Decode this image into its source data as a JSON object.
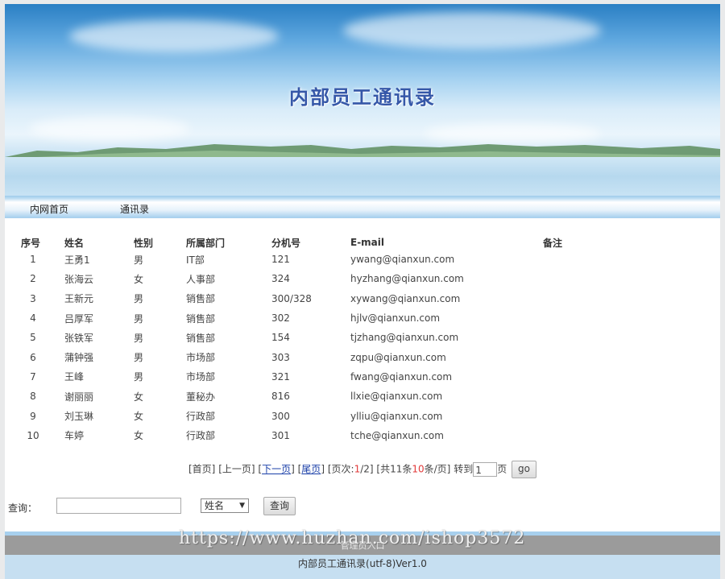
{
  "banner": {
    "title": "内部员工通讯录"
  },
  "nav": {
    "items": [
      "内网首页",
      "通讯录"
    ]
  },
  "table": {
    "headers": [
      "序号",
      "姓名",
      "性别",
      "所属部门",
      "分机号",
      "E-mail",
      "备注"
    ],
    "rows": [
      [
        "1",
        "王勇1",
        "男",
        "IT部",
        "121",
        "ywang@qianxun.com",
        ""
      ],
      [
        "2",
        "张海云",
        "女",
        "人事部",
        "324",
        "hyzhang@qianxun.com",
        ""
      ],
      [
        "3",
        "王新元",
        "男",
        "销售部",
        "300/328",
        "xywang@qianxun.com",
        ""
      ],
      [
        "4",
        "吕厚军",
        "男",
        "销售部",
        "302",
        "hjlv@qianxun.com",
        ""
      ],
      [
        "5",
        "张铁军",
        "男",
        "销售部",
        "154",
        "tjzhang@qianxun.com",
        ""
      ],
      [
        "6",
        "蒲钟强",
        "男",
        "市场部",
        "303",
        "zqpu@qianxun.com",
        ""
      ],
      [
        "7",
        "王峰",
        "男",
        "市场部",
        "321",
        "fwang@qianxun.com",
        ""
      ],
      [
        "8",
        "谢丽丽",
        "女",
        "董秘办",
        "816",
        "llxie@qianxun.com",
        ""
      ],
      [
        "9",
        "刘玉琳",
        "女",
        "行政部",
        "300",
        "ylliu@qianxun.com",
        ""
      ],
      [
        "10",
        "车婷",
        "女",
        "行政部",
        "301",
        "tche@qianxun.com",
        ""
      ]
    ]
  },
  "pager": {
    "first": "[首页]",
    "prev": "[上一页]",
    "next_open": "[",
    "next": "下一页",
    "next_close": "]",
    "last_open": "[",
    "last": "尾页",
    "last_close": "]",
    "pageinfo_prefix": "[页次:",
    "current_page": "1",
    "total_pages": "/2]",
    "total_prefix": "[共11条",
    "per_page": "10",
    "per_page_suffix": "条/页]",
    "goto_label": "转到",
    "goto_value": "1",
    "page_unit": "页",
    "go_label": "go"
  },
  "search": {
    "label": "查询：",
    "input_value": "",
    "field_selected": "姓名",
    "button_label": "查询"
  },
  "footer": {
    "gray_text": "管理员入口",
    "text": "内部员工通讯录(utf-8)Ver1.0"
  },
  "watermark": "https://www.huzhan.com/ishop3572"
}
